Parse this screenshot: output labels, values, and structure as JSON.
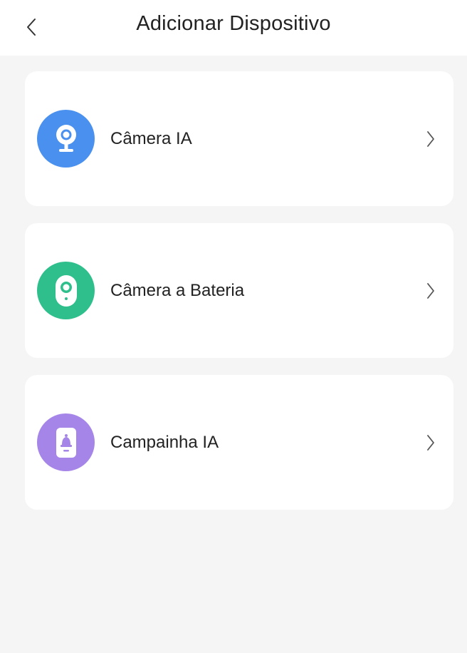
{
  "header": {
    "title": "Adicionar Dispositivo",
    "back_icon": "chevron-left-icon"
  },
  "devices": [
    {
      "label": "Câmera IA",
      "icon": "ai-camera-icon",
      "color": "#4a90ee"
    },
    {
      "label": "Câmera a Bateria",
      "icon": "battery-camera-icon",
      "color": "#2fbf8c"
    },
    {
      "label": "Campainha IA",
      "icon": "doorbell-icon",
      "color": "#a585e8"
    }
  ],
  "colors": {
    "background": "#f5f5f5",
    "card": "#ffffff",
    "text": "#222222",
    "chevron": "#555555"
  }
}
